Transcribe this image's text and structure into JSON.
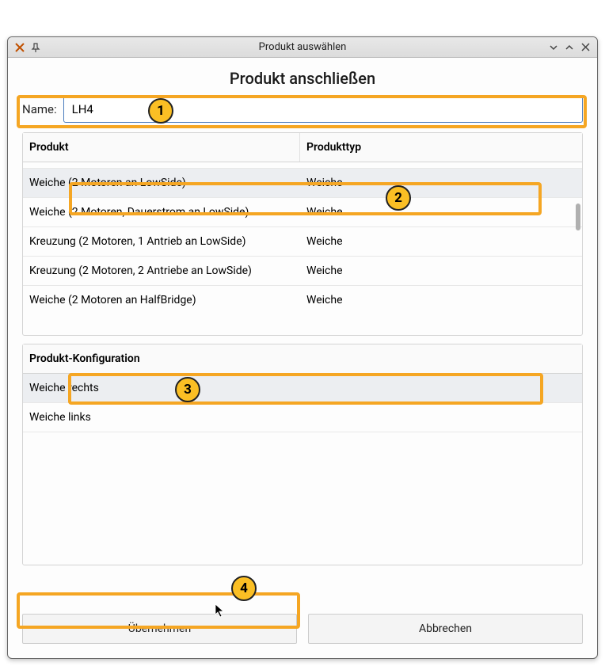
{
  "window": {
    "title": "Produkt auswählen"
  },
  "heading": "Produkt anschließen",
  "name_field": {
    "label": "Name:",
    "value": "LH4"
  },
  "product_table": {
    "columns": {
      "product": "Produkt",
      "type": "Produkttyp"
    },
    "rows": [
      {
        "product": "Weiche (2 Motoren an LowSide)",
        "type": "Weiche",
        "selected": true
      },
      {
        "product": "Weiche (2 Motoren, Dauerstrom an LowSide)",
        "type": "Weiche",
        "selected": false
      },
      {
        "product": "Kreuzung (2 Motoren, 1 Antrieb an LowSide)",
        "type": "Weiche",
        "selected": false
      },
      {
        "product": "Kreuzung (2 Motoren, 2 Antriebe an LowSide)",
        "type": "Weiche",
        "selected": false
      },
      {
        "product": "Weiche (2 Motoren an HalfBridge)",
        "type": "Weiche",
        "selected": false
      }
    ]
  },
  "config_table": {
    "header": "Produkt-Konfiguration",
    "rows": [
      {
        "label": "Weiche rechts",
        "selected": true
      },
      {
        "label": "Weiche links",
        "selected": false
      }
    ]
  },
  "buttons": {
    "apply": "Übernehmen",
    "cancel": "Abbrechen"
  },
  "annotations": [
    {
      "n": "1"
    },
    {
      "n": "2"
    },
    {
      "n": "3"
    },
    {
      "n": "4"
    }
  ]
}
